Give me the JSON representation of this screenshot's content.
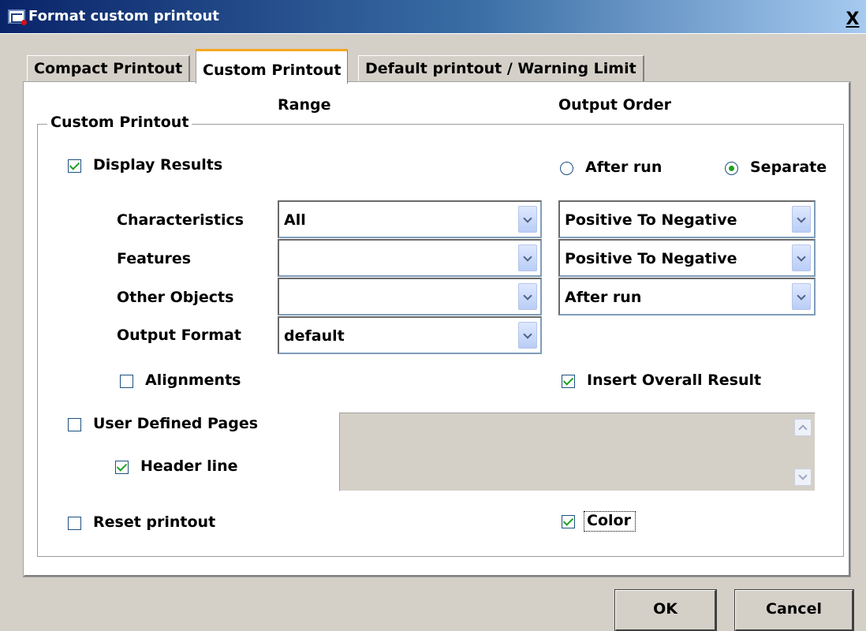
{
  "window": {
    "title": "Format custom printout",
    "close_glyph": "X"
  },
  "tabs": [
    {
      "label": "Compact Printout",
      "active": false
    },
    {
      "label": "Custom Printout",
      "active": true
    },
    {
      "label": "Default printout / Warning Limit",
      "active": false
    }
  ],
  "headers": {
    "range": "Range",
    "output_order": "Output Order"
  },
  "group": {
    "label": "Custom Printout"
  },
  "display_results": {
    "label": "Display Results",
    "checked": true
  },
  "output_order_radio": {
    "after_run": {
      "label": "After run",
      "selected": false
    },
    "separate": {
      "label": "Separate",
      "selected": true
    }
  },
  "rows": [
    {
      "label": "Characteristics",
      "range_value": "All",
      "order_value": "Positive To Negative"
    },
    {
      "label": "Features",
      "range_value": "",
      "order_value": "Positive To Negative"
    },
    {
      "label": "Other Objects",
      "range_value": "",
      "order_value": "After run"
    },
    {
      "label": "Output Format",
      "range_value": "default"
    }
  ],
  "alignments": {
    "label": "Alignments",
    "checked": false
  },
  "insert_overall_result": {
    "label": "Insert Overall Result",
    "checked": true
  },
  "user_defined_pages": {
    "label": "User Defined Pages",
    "checked": false
  },
  "header_line": {
    "label": "Header line",
    "checked": true
  },
  "reset_printout": {
    "label": "Reset printout",
    "checked": false
  },
  "color": {
    "label": "Color",
    "checked": true
  },
  "buttons": {
    "ok": "OK",
    "cancel": "Cancel"
  },
  "colors": {
    "accent_tab": "#f5a623",
    "check_green": "#21a121",
    "title_bar": "#0a246a"
  }
}
